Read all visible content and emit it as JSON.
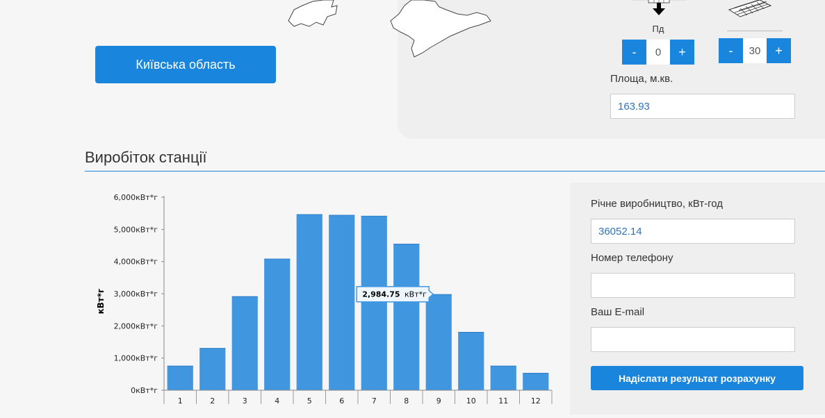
{
  "region_button": "Київська область",
  "orientation": {
    "direction_label": "Пд",
    "direction": {
      "minus": "-",
      "value": "0",
      "plus": "+"
    },
    "tilt": {
      "minus": "-",
      "value": "30",
      "plus": "+"
    }
  },
  "area": {
    "label": "Площа, м.кв.",
    "value": "163.93"
  },
  "section_title": "Виробіток станції",
  "form": {
    "annual_label": "Річне виробництво, кВт-год",
    "annual_value": "36052.14",
    "phone_label": "Номер телефону",
    "phone_value": "",
    "email_label": "Ваш E-mail",
    "email_value": "",
    "submit_label": "Надіслати результат розрахунку"
  },
  "colors": {
    "accent": "#1a85dd",
    "bar": "#4196e0",
    "panel_bg": "#efefef"
  },
  "chart_data": {
    "type": "bar",
    "categories": [
      "1",
      "2",
      "3",
      "4",
      "5",
      "6",
      "7",
      "8",
      "9",
      "10",
      "11",
      "12"
    ],
    "values": [
      760,
      1310,
      2920,
      4090,
      5470,
      5450,
      5420,
      4550,
      2984.75,
      1810,
      760,
      540
    ],
    "ylabel": "кВт*г",
    "ylim": [
      0,
      6000
    ],
    "yticks": [
      "0кВт*г",
      "1,000кВт*г",
      "2,000кВт*г",
      "3,000кВт*г",
      "4,000кВт*г",
      "5,000кВт*г",
      "6,000кВт*г"
    ],
    "tooltip": {
      "category": "9",
      "value_text": "2,984.75",
      "unit": "кВт*г"
    }
  }
}
